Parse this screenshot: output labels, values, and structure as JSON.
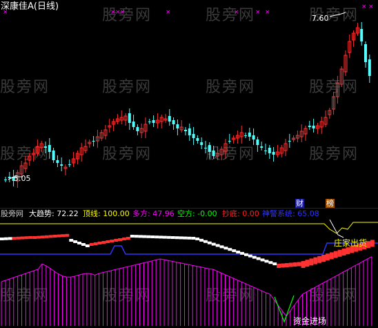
{
  "window": {
    "stock_title": "深康佳A(日线)"
  },
  "watermark": {
    "text": "股旁网"
  },
  "price_chart": {
    "high_label": "7.60",
    "low_label": "5.05",
    "badge_finance": "财",
    "badge_list": "榜"
  },
  "indicator_header": {
    "source": "股旁网",
    "big_trend": "大趋势: 72.22",
    "top_line": "顶线: 100.00",
    "long_side": "多方: 47.96",
    "short_side": "空方: -0.00",
    "bottom_pick": "抄底: 0.00",
    "warning": "神警系统: 65.08"
  },
  "annotations": {
    "dealer_exit": "庄家出货",
    "capital_in": "资金进场"
  },
  "colors": {
    "background": "#000000",
    "up_candle": "#ff3232",
    "down_candle": "#54ffff",
    "yellow_text": "#ffff00",
    "magenta": "#ff00ff",
    "green": "#00ff00",
    "blue": "#3232ff"
  }
}
